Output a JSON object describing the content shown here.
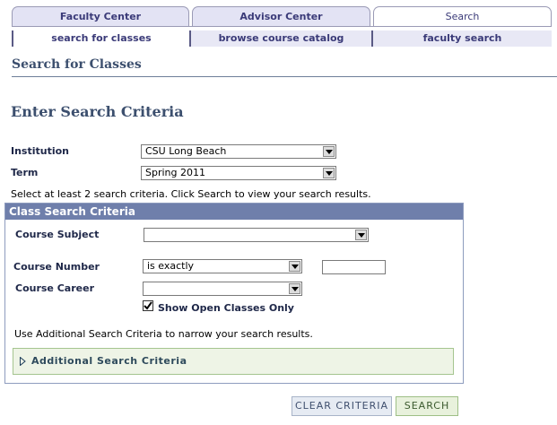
{
  "tabs": [
    {
      "label": "Faculty Center",
      "active": false
    },
    {
      "label": "Advisor Center",
      "active": false
    },
    {
      "label": "Search",
      "active": true
    }
  ],
  "subtabs": [
    {
      "label": "search for classes",
      "active": true
    },
    {
      "label": "browse course catalog",
      "active": false
    },
    {
      "label": "faculty search",
      "active": false
    }
  ],
  "page": {
    "title": "Search for Classes",
    "section_title": "Enter Search Criteria",
    "instructions": "Select at least 2 search criteria. Click Search to view your search results."
  },
  "form": {
    "institution": {
      "label": "Institution",
      "value": "CSU Long Beach"
    },
    "term": {
      "label": "Term",
      "value": "Spring 2011"
    }
  },
  "criteria": {
    "header": "Class Search Criteria",
    "course_subject": {
      "label": "Course Subject",
      "value": ""
    },
    "course_number": {
      "label": "Course Number",
      "operator": "is exactly",
      "value": ""
    },
    "course_career": {
      "label": "Course Career",
      "value": ""
    },
    "open_only": {
      "label": "Show Open Classes Only",
      "checked": true
    },
    "note": "Use Additional Search Criteria to narrow your search results.",
    "additional": "Additional Search Criteria"
  },
  "buttons": {
    "clear": "Clear Criteria",
    "search": "Search"
  },
  "colors": {
    "tab_text": "#3a3a78",
    "heading": "#3c4f6e",
    "group_header": "#6f7fab",
    "additional_bg": "#eef4e6"
  }
}
